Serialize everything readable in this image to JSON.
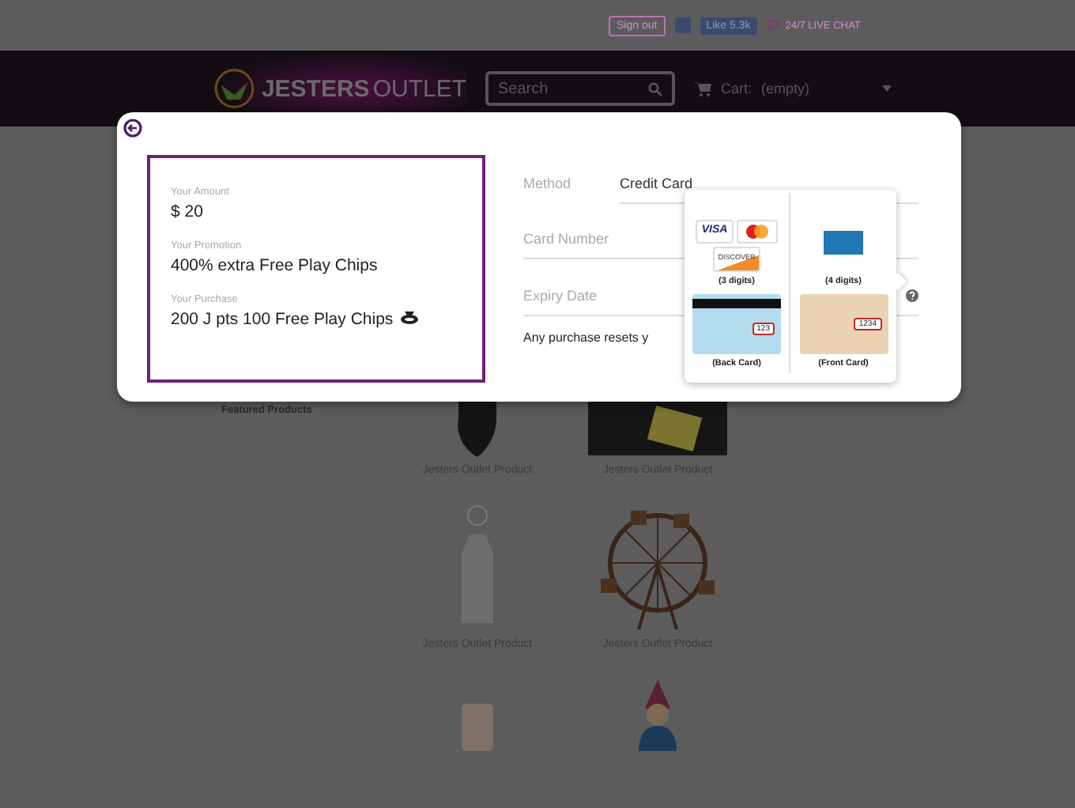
{
  "top_bar": {
    "sign_out": "Sign out",
    "like": "Like 5.3k",
    "live_chat": "24/7 LIVE CHAT"
  },
  "header": {
    "logo_bold": "JESTERS",
    "logo_light": "OUTLET",
    "search": {
      "placeholder": "Search"
    },
    "cart_label": "Cart:",
    "cart_value": "(empty)"
  },
  "sidebar": {
    "title": "Featured Products"
  },
  "products": [
    {
      "name": "Jesters Outlet Product",
      "kind": "figure"
    },
    {
      "name": "Jesters Outlet Product",
      "kind": "dark"
    },
    {
      "name": "Jesters Outlet Product",
      "kind": "lantern"
    },
    {
      "name": "Jesters Outlet Product",
      "kind": "wheel"
    },
    {
      "kind": "phone"
    },
    {
      "kind": "gnome"
    }
  ],
  "modal": {
    "summary": [
      {
        "label": "Your Amount",
        "value": "$ 20",
        "chip_icon": false
      },
      {
        "label": "Your Promotion",
        "value": "400% extra Free Play Chips",
        "chip_icon": false
      },
      {
        "label": "Your Purchase",
        "value": "200 J pts 100 Free Play Chips",
        "chip_icon": true
      }
    ],
    "form": [
      {
        "label": "Method",
        "value": "Credit Card",
        "help": false
      },
      {
        "label": "Card Number",
        "help": false
      },
      {
        "label": "Expiry Date",
        "help": true
      }
    ],
    "note": "Any purchase resets y",
    "cvv_popover": {
      "brands": {
        "visa": "VISA",
        "discover": "DISCOVER"
      },
      "captions": [
        "(3 digits)",
        "(4 digits)",
        "(Back Card)",
        "(Front Card)"
      ],
      "back_code": "123",
      "front_code": "1234"
    }
  }
}
